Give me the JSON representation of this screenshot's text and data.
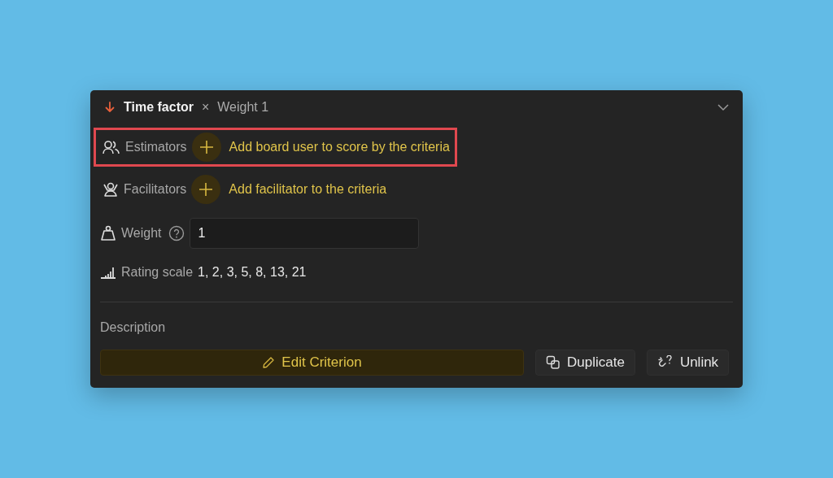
{
  "header": {
    "title": "Time factor",
    "separator": "×",
    "weight": "Weight 1",
    "expanded": true
  },
  "people": [
    {
      "kind": "estimators",
      "label": "Estimators",
      "action": "Add board user to score by the criteria",
      "highlighted": true
    },
    {
      "kind": "facilitators",
      "label": "Facilitators",
      "action": "Add facilitator to the criteria",
      "highlighted": false
    }
  ],
  "weight": {
    "label": "Weight",
    "value": "1"
  },
  "rating_scale": {
    "label": "Rating scale",
    "values": "1, 2, 3, 5, 8, 13, 21"
  },
  "description": {
    "label": "Description"
  },
  "buttons": [
    {
      "kind": "edit",
      "label": "Edit Criterion"
    },
    {
      "kind": "duplicate",
      "label": "Duplicate"
    },
    {
      "kind": "unlink",
      "label": "Unlink"
    }
  ]
}
